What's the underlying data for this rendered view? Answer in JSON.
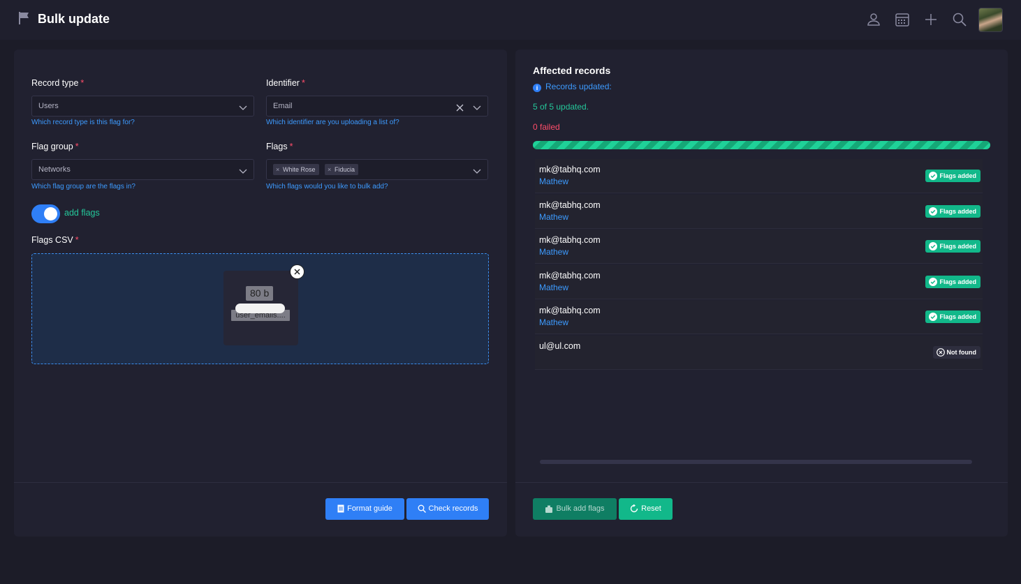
{
  "header": {
    "title": "Bulk update"
  },
  "form": {
    "record_type": {
      "label": "Record type",
      "required": "*",
      "value": "Users",
      "help": "Which record type is this flag for?"
    },
    "identifier": {
      "label": "Identifier",
      "required": "*",
      "value": "Email",
      "help": "Which identifier are you uploading a list of?"
    },
    "flag_group": {
      "label": "Flag group",
      "required": "*",
      "value": "Networks",
      "help": "Which flag group are the flags in?"
    },
    "flags": {
      "label": "Flags",
      "required": "*",
      "tags": [
        "White Rose",
        "Fiducia"
      ],
      "help": "Which flags would you like to bulk add?"
    },
    "toggle": {
      "label": "add flags",
      "on": true
    },
    "csv": {
      "label": "Flags CSV",
      "required": "*",
      "file_size": "80 b",
      "file_name": "user_emails...."
    },
    "buttons": {
      "format_guide": "Format guide",
      "check_records": "Check records"
    }
  },
  "results": {
    "title": "Affected records",
    "info": "Records updated:",
    "updated": "5 of 5 updated.",
    "failed": "0 failed",
    "progress": 1.0,
    "rows": [
      {
        "email": "mk@tabhq.com",
        "name": "Mathew",
        "status": "Flags added",
        "ok": true
      },
      {
        "email": "mk@tabhq.com",
        "name": "Mathew",
        "status": "Flags added",
        "ok": true
      },
      {
        "email": "mk@tabhq.com",
        "name": "Mathew",
        "status": "Flags added",
        "ok": true
      },
      {
        "email": "mk@tabhq.com",
        "name": "Mathew",
        "status": "Flags added",
        "ok": true
      },
      {
        "email": "mk@tabhq.com",
        "name": "Mathew",
        "status": "Flags added",
        "ok": true
      },
      {
        "email": "ul@ul.com",
        "name": "",
        "status": "Not found",
        "ok": false
      }
    ],
    "buttons": {
      "bulk_add": "Bulk add flags",
      "reset": "Reset"
    }
  },
  "colors": {
    "accent_blue": "#2f7ff6",
    "success_green": "#12b88a",
    "error_red": "#ff4d6a"
  },
  "icons": [
    "flag-icon",
    "user-icon",
    "calendar-icon",
    "plus-icon",
    "search-icon",
    "chevron-down-icon",
    "close-icon",
    "info-icon",
    "check-circle-icon",
    "x-circle-icon",
    "document-icon",
    "trash-icon",
    "refresh-icon"
  ]
}
